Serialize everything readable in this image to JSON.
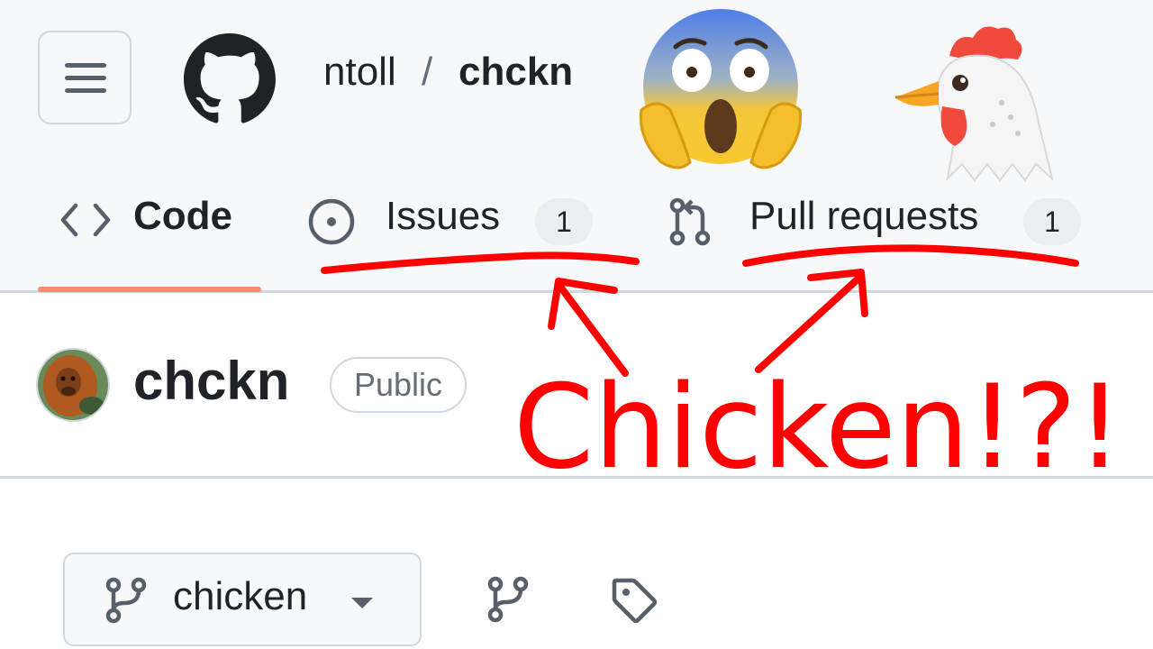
{
  "header": {
    "owner": "ntoll",
    "separator": "/",
    "repo": "chckn",
    "menu_icon": "hamburger-icon",
    "logo_icon": "github-logo-icon",
    "decorations": [
      "face-screaming-in-fear-emoji",
      "chicken-emoji"
    ]
  },
  "tabs": [
    {
      "label": "Code",
      "icon": "code-icon",
      "selected": true
    },
    {
      "label": "Issues",
      "icon": "issue-opened-icon",
      "count": "1"
    },
    {
      "label": "Pull requests",
      "icon": "git-pull-request-icon",
      "count": "1"
    }
  ],
  "repo_header": {
    "title": "chckn",
    "visibility": "Public",
    "avatar": "orangutan-avatar"
  },
  "branch_bar": {
    "branch": "chicken",
    "branch_icon": "git-branch-icon",
    "branches_icon": "git-branch-icon",
    "tags_icon": "tag-icon"
  },
  "annotation": {
    "text": "Chicken!?!",
    "color": "#ff0000"
  },
  "colors": {
    "header_bg": "#f6f8fa",
    "selected_tab_underline": "#fd8c73",
    "border": "#d0d7de"
  }
}
